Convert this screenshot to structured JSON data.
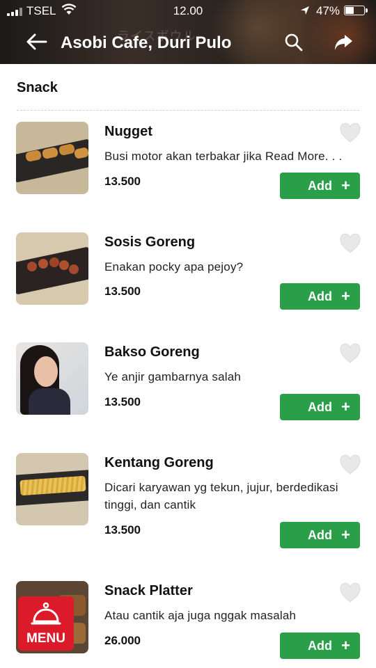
{
  "status_bar": {
    "carrier": "TSEL",
    "time": "12.00",
    "battery": "47%",
    "battery_level": 0.47
  },
  "header": {
    "title": "Asobi Cafe, Duri Pulo",
    "background_text": "ライスボウル"
  },
  "section": {
    "title": "Snack"
  },
  "items": [
    {
      "name": "Nugget",
      "description": "Busi motor akan terbakar jika Read More. . .",
      "price": "13.500",
      "add_label": "Add",
      "add_icon": "+",
      "image": "nuggets-photo"
    },
    {
      "name": "Sosis Goreng",
      "description": "Enakan pocky apa pejoy?",
      "price": "13.500",
      "add_label": "Add",
      "add_icon": "+",
      "image": "fried-sausage-photo"
    },
    {
      "name": "Bakso Goreng",
      "description": "Ye anjir gambarnya salah",
      "price": "13.500",
      "add_label": "Add",
      "add_icon": "+",
      "image": "selfie-photo"
    },
    {
      "name": "Kentang Goreng",
      "description": "Dicari karyawan yg tekun, jujur, berdedikasi tinggi, dan cantik",
      "price": "13.500",
      "add_label": "Add",
      "add_icon": "+",
      "image": "french-fries-photo"
    },
    {
      "name": "Snack Platter",
      "description": "Atau cantik aja juga nggak masalah",
      "price": "26.000",
      "add_label": "Add",
      "add_icon": "+",
      "image": "snack-platter-photo"
    }
  ],
  "menu_button": {
    "label": "MENU"
  },
  "colors": {
    "accent_green": "#2a9e48",
    "menu_red": "#dc1b2a",
    "heart_gray": "#e6e6e6"
  }
}
